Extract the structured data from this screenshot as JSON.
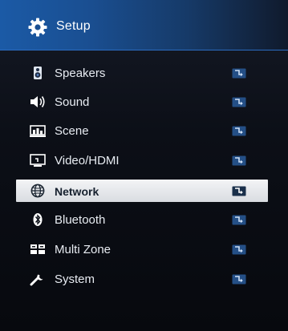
{
  "header": {
    "title": "Setup",
    "icon": "gear-icon"
  },
  "colors": {
    "header_blue": "#1b5aa6",
    "selected_bg": "#e6e8eb",
    "text": "#e8ecf2",
    "enter_icon": "#3f7fc9"
  },
  "menu": {
    "selected_index": 4,
    "items": [
      {
        "label": "Speakers",
        "icon": "speaker-icon"
      },
      {
        "label": "Sound",
        "icon": "sound-icon"
      },
      {
        "label": "Scene",
        "icon": "scene-icon"
      },
      {
        "label": "Video/HDMI",
        "icon": "video-hdmi-icon"
      },
      {
        "label": "Network",
        "icon": "network-icon"
      },
      {
        "label": "Bluetooth",
        "icon": "bluetooth-icon"
      },
      {
        "label": "Multi Zone",
        "icon": "multi-zone-icon"
      },
      {
        "label": "System",
        "icon": "wrench-icon"
      }
    ],
    "enter_icon": "enter-arrow-icon"
  }
}
